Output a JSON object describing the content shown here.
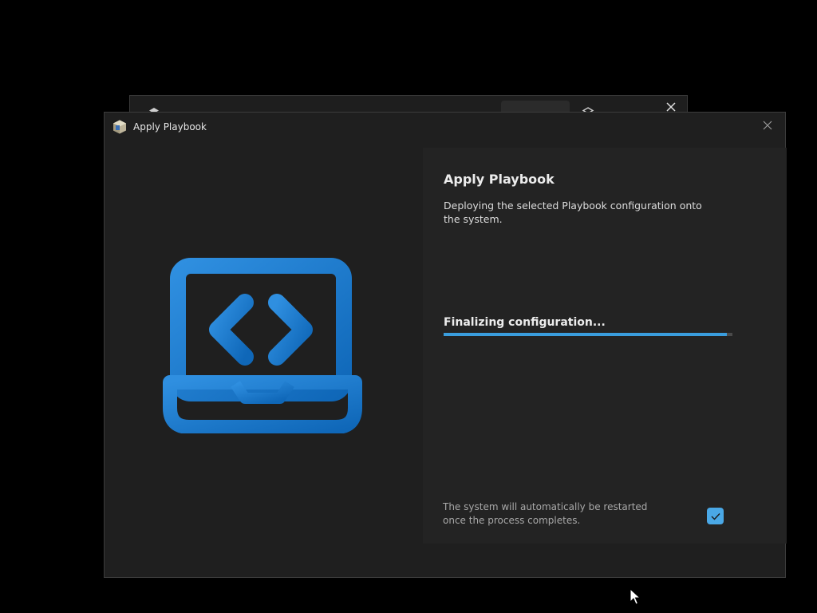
{
  "background_window": {
    "close_glyph": "✕"
  },
  "dialog": {
    "window_title": "Apply Playbook",
    "close_glyph": "✕",
    "illustration_icon": "laptop-code-icon"
  },
  "panel": {
    "title": "Apply Playbook",
    "description": "Deploying the selected Playbook configuration onto the system.",
    "status": "Finalizing configuration...",
    "progress_fraction": 0.98,
    "restart_note": "The system will automatically be restarted once the process completes.",
    "restart_checked": true
  },
  "colors": {
    "accent": "#3a9ddd",
    "checkbox": "#4aa8e6",
    "illustration_dark": "#0f67b8",
    "illustration_light": "#2f8fe0"
  }
}
